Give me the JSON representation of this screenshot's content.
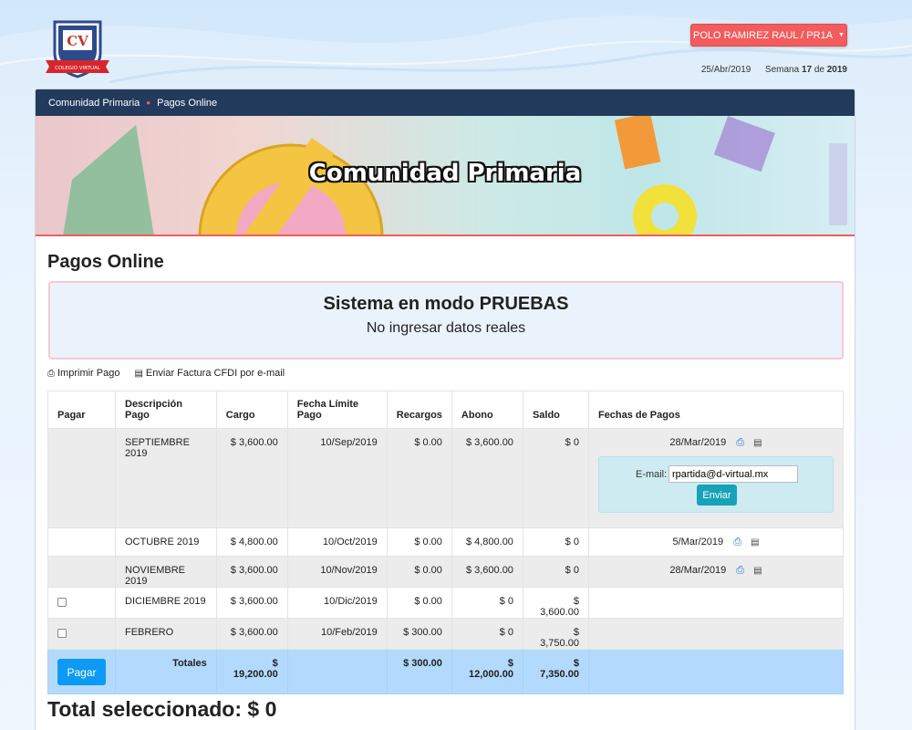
{
  "header": {
    "logo_text": "CV",
    "logo_ribbon": "COLEGIO VIRTUAL",
    "user_button": "POLO RAMIREZ RAUL / PR1A",
    "date": "25/Abr/2019",
    "week_label": "Semana",
    "week_number": "17",
    "week_of": "de",
    "week_year": "2019"
  },
  "breadcrumb": {
    "items": [
      "Comunidad Primaria",
      "Pagos Online"
    ]
  },
  "banner": {
    "title": "Comunidad Primaria"
  },
  "page": {
    "title": "Pagos Online"
  },
  "alert": {
    "title": "Sistema en modo PRUEBAS",
    "subtitle": "No ingresar datos reales"
  },
  "actions": {
    "print": "Imprimir Pago",
    "send_invoice": "Enviar Factura CFDI por e-mail"
  },
  "table": {
    "headers": [
      "Pagar",
      "Descripción Pago",
      "Cargo",
      "Fecha Límite Pago",
      "Recargos",
      "Abono",
      "Saldo",
      "Fechas de Pagos"
    ],
    "rows": [
      {
        "desc": "SEPTIEMBRE 2019",
        "cargo": "$ 3,600.00",
        "fecha": "10/Sep/2019",
        "recargos": "$ 0.00",
        "abono": "$ 3,600.00",
        "saldo": "$ 0",
        "pago_fecha": "28/Mar/2019"
      },
      {
        "desc": "OCTUBRE 2019",
        "cargo": "$ 4,800.00",
        "fecha": "10/Oct/2019",
        "recargos": "$ 0.00",
        "abono": "$ 4,800.00",
        "saldo": "$ 0",
        "pago_fecha": "5/Mar/2019"
      },
      {
        "desc": "NOVIEMBRE 2019",
        "cargo": "$ 3,600.00",
        "fecha": "10/Nov/2019",
        "recargos": "$ 0.00",
        "abono": "$ 3,600.00",
        "saldo": "$ 0",
        "pago_fecha": "28/Mar/2019"
      },
      {
        "desc": "DICIEMBRE 2019",
        "cargo": "$ 3,600.00",
        "fecha": "10/Dic/2019",
        "recargos": "$ 0.00",
        "abono": "$ 0",
        "saldo": "$ 3,600.00",
        "pago_fecha": ""
      },
      {
        "desc": "FEBRERO",
        "cargo": "$ 3,600.00",
        "fecha": "10/Feb/2019",
        "recargos": "$ 300.00",
        "abono": "$ 0",
        "saldo": "$ 3,750.00",
        "pago_fecha": ""
      }
    ],
    "email_label": "E-mail:",
    "email_value": "rpartida@d-virtual.mx",
    "send_button": "Enviar",
    "totals": {
      "button": "Pagar",
      "label": "Totales",
      "cargo_symbol": "$",
      "cargo": "19,200.00",
      "recargos": "$ 300.00",
      "abono_symbol": "$",
      "abono": "12,000.00",
      "saldo_symbol": "$",
      "saldo": "7,350.00"
    }
  },
  "total_selected": "Total seleccionado: $ 0",
  "colors": {
    "nav": "#223a5c",
    "accent_red": "#f25c5c",
    "totals_row": "#b3dafc",
    "pay_button": "#0d9af5",
    "send_button": "#17a2b8"
  },
  "icons": [
    "print-icon",
    "document-icon",
    "caret-down-icon"
  ]
}
